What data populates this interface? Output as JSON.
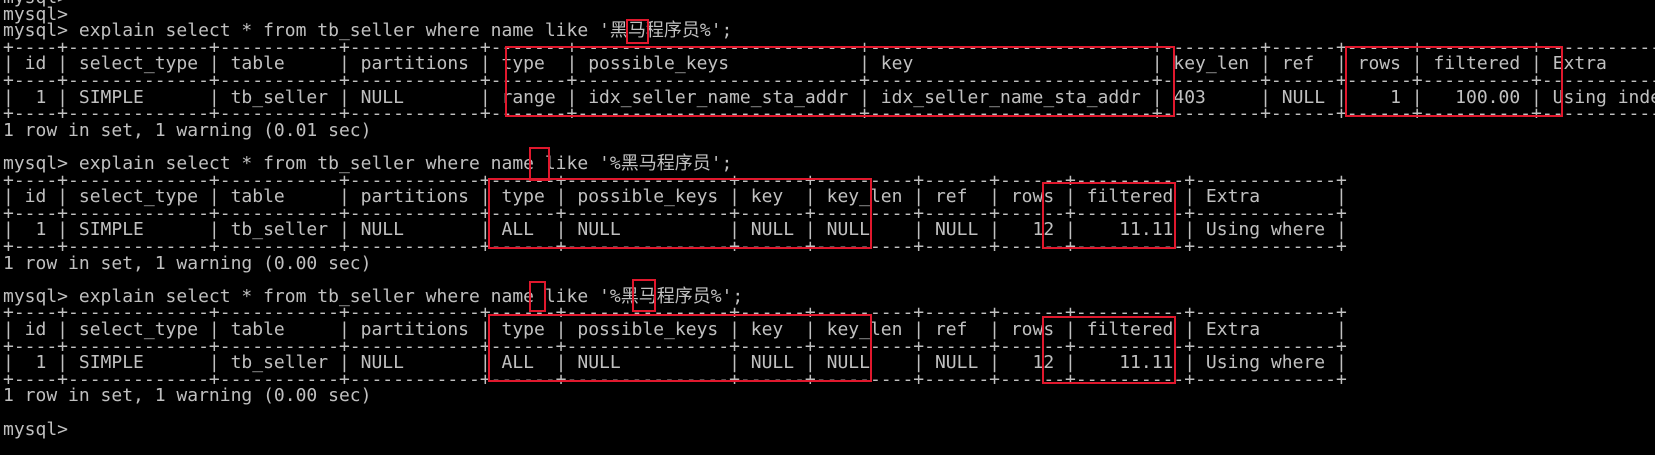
{
  "terminal": {
    "lines": [
      "mysql>",
      "mysql>",
      "mysql> explain select * from tb_seller where name like '黑马程序员%';",
      "+----+-------------+-----------+------------+-------+--------------------------+--------------------------+---------+------+------+----------+-----------------------+",
      "| id | select_type | table     | partitions | type  | possible_keys            | key                      | key_len | ref  | rows | filtered | Extra                 |",
      "+----+-------------+-----------+------------+-------+--------------------------+--------------------------+---------+------+------+----------+-----------------------+",
      "|  1 | SIMPLE      | tb_seller | NULL       | range | idx_seller_name_sta_addr | idx_seller_name_sta_addr | 403     | NULL |    1 |   100.00 | Using index condition |",
      "+----+-------------+-----------+------------+-------+--------------------------+--------------------------+---------+------+------+----------+-----------------------+",
      "1 row in set, 1 warning (0.01 sec)",
      "",
      "mysql> explain select * from tb_seller where name like '%黑马程序员';",
      "+----+-------------+-----------+------------+------+---------------+------+---------+------+------+----------+-------------+",
      "| id | select_type | table     | partitions | type | possible_keys | key  | key_len | ref  | rows | filtered | Extra       |",
      "+----+-------------+-----------+------------+------+---------------+------+---------+------+------+----------+-------------+",
      "|  1 | SIMPLE      | tb_seller | NULL       | ALL  | NULL          | NULL | NULL    | NULL |   12 |    11.11 | Using where |",
      "+----+-------------+-----------+------------+------+---------------+------+---------+------+------+----------+-------------+",
      "1 row in set, 1 warning (0.00 sec)",
      "",
      "mysql> explain select * from tb_seller where name like '%黑马程序员%';",
      "+----+-------------+-----------+------------+------+---------------+------+---------+------+------+----------+-------------+",
      "| id | select_type | table     | partitions | type | possible_keys | key  | key_len | ref  | rows | filtered | Extra       |",
      "+----+-------------+-----------+------------+------+---------------+------+---------+------+------+----------+-------------+",
      "|  1 | SIMPLE      | tb_seller | NULL       | ALL  | NULL          | NULL | NULL    | NULL |   12 |    11.11 | Using where |",
      "+----+-------------+-----------+------------+------+---------------+------+---------+------+------+----------+-------------+",
      "1 row in set, 1 warning (0.00 sec)",
      "",
      "mysql>"
    ]
  },
  "highlight_color": "#e0182d"
}
